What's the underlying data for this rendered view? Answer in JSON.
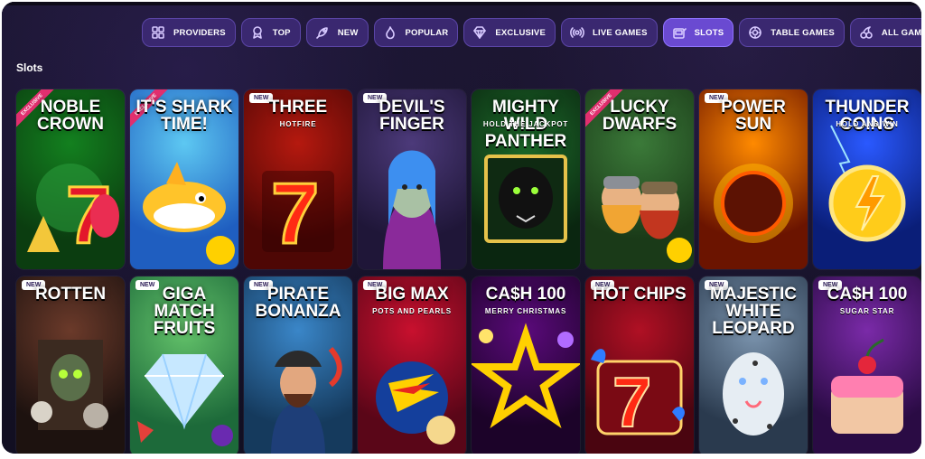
{
  "nav": {
    "items": [
      {
        "label": "PROVIDERS",
        "icon": "grid-icon",
        "active": false
      },
      {
        "label": "TOP",
        "icon": "medal-icon",
        "active": false
      },
      {
        "label": "NEW",
        "icon": "rocket-icon",
        "active": false
      },
      {
        "label": "POPULAR",
        "icon": "flame-icon",
        "active": false
      },
      {
        "label": "EXCLUSIVE",
        "icon": "diamond-icon",
        "active": false
      },
      {
        "label": "LIVE GAMES",
        "icon": "broadcast-icon",
        "active": false
      },
      {
        "label": "SLOTS",
        "icon": "slot-machine-icon",
        "active": true
      },
      {
        "label": "TABLE GAMES",
        "icon": "poker-chip-icon",
        "active": false
      },
      {
        "label": "ALL GAMES",
        "icon": "cherries-icon",
        "active": false
      }
    ]
  },
  "section": {
    "title": "Slots"
  },
  "games": [
    {
      "title": "NOBLE CROWN",
      "subtitle": "",
      "badge": "",
      "ribbon": "EXCLUSIVE",
      "bg": [
        "#13801f",
        "#0b3d10"
      ],
      "art": "seven"
    },
    {
      "title": "IT'S SHARK TIME!",
      "subtitle": "",
      "badge": "",
      "ribbon": "EXCLUSIVE",
      "bg": [
        "#5dc8f2",
        "#1f5ec0"
      ],
      "art": "shark"
    },
    {
      "title": "THREE",
      "subtitle": "HOTFIRE",
      "badge": "NEW",
      "ribbon": "",
      "bg": [
        "#b5190f",
        "#4e0705"
      ],
      "art": "seven-fire"
    },
    {
      "title": "DEVIL'S FINGER",
      "subtitle": "",
      "badge": "NEW",
      "ribbon": "",
      "bg": [
        "#4c3a7a",
        "#1f1638"
      ],
      "art": "devil"
    },
    {
      "title": "MIGHTY WILD PANTHER",
      "subtitle": "HOLD THE JACKPOT",
      "badge": "",
      "ribbon": "",
      "bg": [
        "#1d6b2a",
        "#0a2610"
      ],
      "art": "panther"
    },
    {
      "title": "LUCKY DWARFS",
      "subtitle": "",
      "badge": "",
      "ribbon": "EXCLUSIVE",
      "bg": [
        "#3b7a39",
        "#1a3a18"
      ],
      "art": "dwarfs"
    },
    {
      "title": "POWER SUN",
      "subtitle": "",
      "badge": "NEW",
      "ribbon": "",
      "bg": [
        "#ff8a00",
        "#6b1400"
      ],
      "art": "sun"
    },
    {
      "title": "THUNDER COINS",
      "subtitle": "HOLD AND WIN",
      "badge": "",
      "ribbon": "",
      "bg": [
        "#2a59ff",
        "#0a1e78"
      ],
      "art": "coin"
    },
    {
      "title": "ROTTEN",
      "subtitle": "",
      "badge": "NEW",
      "ribbon": "",
      "bg": [
        "#6b3a2a",
        "#1d120f"
      ],
      "art": "rotten"
    },
    {
      "title": "GIGA MATCH FRUITS",
      "subtitle": "",
      "badge": "NEW",
      "ribbon": "",
      "bg": [
        "#63c26a",
        "#1d6a3a"
      ],
      "art": "diamond"
    },
    {
      "title": "PIRATE BONANZA",
      "subtitle": "",
      "badge": "NEW",
      "ribbon": "",
      "bg": [
        "#3a86c8",
        "#153a5d"
      ],
      "art": "pirate"
    },
    {
      "title": "BIG MAX",
      "subtitle": "POTS AND PEARLS",
      "badge": "NEW",
      "ribbon": "",
      "bg": [
        "#c8102e",
        "#5a0618"
      ],
      "art": "bigmax"
    },
    {
      "title": "CA$H 100",
      "subtitle": "MERRY CHRISTMAS",
      "badge": "",
      "ribbon": "",
      "bg": [
        "#5a0a7a",
        "#1c0329"
      ],
      "art": "star"
    },
    {
      "title": "HOT CHIPS",
      "subtitle": "",
      "badge": "NEW",
      "ribbon": "",
      "bg": [
        "#b01024",
        "#4a0510"
      ],
      "art": "hotchips"
    },
    {
      "title": "MAJESTIC WHITE LEOPARD",
      "subtitle": "",
      "badge": "NEW",
      "ribbon": "",
      "bg": [
        "#7d96b0",
        "#2a3a4e"
      ],
      "art": "leopard"
    },
    {
      "title": "CA$H 100",
      "subtitle": "SUGAR STAR",
      "badge": "NEW",
      "ribbon": "",
      "bg": [
        "#7a2aa8",
        "#2a0b44"
      ],
      "art": "cake"
    }
  ],
  "colors": {
    "background": "#17132a",
    "pill": "#3a2870",
    "pill_active": "#6a4ad1",
    "badge": "#ffffff",
    "ribbon": "#e12f6f"
  }
}
